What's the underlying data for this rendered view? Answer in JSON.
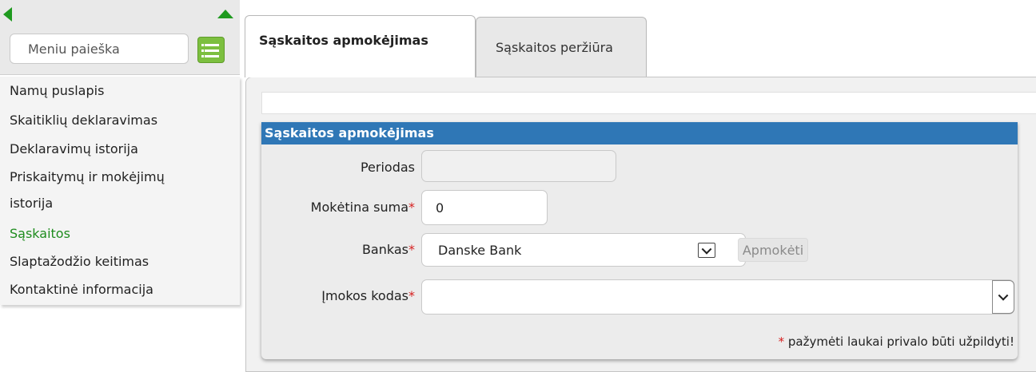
{
  "sidebar": {
    "search_placeholder": "Meniu paieška",
    "items": [
      {
        "label": "Namų puslapis"
      },
      {
        "label": "Skaitiklių deklaravimas"
      },
      {
        "label": "Deklaravimų istorija"
      },
      {
        "label": "Priskaitymų ir mokėjimų"
      },
      {
        "label": "istorija"
      },
      {
        "label": "Sąskaitos"
      },
      {
        "label": "Slaptažodžio keitimas"
      },
      {
        "label": "Kontaktinė informacija"
      }
    ],
    "active_color": "#1e8c1e"
  },
  "tabs": [
    {
      "label": "Sąskaitos apmokėjimas"
    },
    {
      "label": "Sąskaitos peržiūra"
    }
  ],
  "form": {
    "header": "Sąskaitos apmokėjimas",
    "period_label": "Periodas",
    "period_value": "",
    "amount_label": "Mokėtina suma",
    "amount_value": "0",
    "bank_label": "Bankas",
    "bank_value": "Danske Bank",
    "pay_button": "Apmokėti",
    "code_label": "Įmokos kodas",
    "code_value": "",
    "required_mark": "*",
    "required_note": "pažymėti laukai privalo būti užpildyti!"
  },
  "colors": {
    "header_blue": "#2f77b6",
    "green": "#1f9a1f",
    "required_red": "#d61f1f"
  },
  "icons": {
    "collapse_left": "triangle-left-icon",
    "collapse_up": "triangle-up-icon",
    "menu_toggle": "list-icon",
    "dropdown": "chevron-down-icon"
  }
}
